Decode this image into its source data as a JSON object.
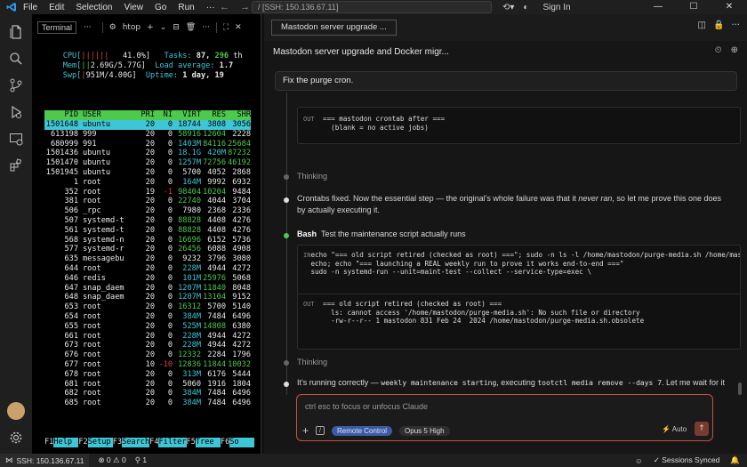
{
  "titlebar": {
    "menus": [
      "File",
      "Edit",
      "Selection",
      "View",
      "Go",
      "Run",
      "···"
    ],
    "command_center": "/ [SSH: 150.136.67.11]",
    "sign_in": "Sign In"
  },
  "terminal": {
    "tab_label": "Terminal",
    "tab_more": "···",
    "process_name": "htop",
    "meters": {
      "cpu_label": "CPU[",
      "cpu_bar": "||||||",
      "cpu_value": "41.0%]",
      "mem_label": "Mem[",
      "mem_bar": "||",
      "mem_value": "2.69G/5.77G]",
      "swp_label": "Swp[",
      "swp_bar": "|",
      "swp_value": "951M/4.00G]",
      "tasks_label": "Tasks:",
      "tasks_value": "87,",
      "threads_value": "296",
      "threads_suffix": "th",
      "load_label": "Load average:",
      "load_value": "1.7",
      "uptime_label": "Uptime:",
      "uptime_value": "1 day, 19"
    },
    "columns": [
      "PID",
      "USER",
      "PRI",
      "NI",
      "VIRT",
      "RES",
      "SHR"
    ],
    "rows": [
      {
        "pid": "1501648",
        "user": "ubuntu",
        "pri": "20",
        "ni": "0",
        "virt": "18744",
        "res": "3808",
        "shr": "3056"
      },
      {
        "pid": "613198",
        "user": "999",
        "pri": "20",
        "ni": "0",
        "virt": "58916",
        "res": "12604",
        "shr": "2228"
      },
      {
        "pid": "680999",
        "user": "991",
        "pri": "20",
        "ni": "0",
        "virt": "1403M",
        "res": "84116",
        "shr": "25684"
      },
      {
        "pid": "1501436",
        "user": "ubuntu",
        "pri": "20",
        "ni": "0",
        "virt": "18.1G",
        "res": "420M",
        "shr": "87232"
      },
      {
        "pid": "1501470",
        "user": "ubuntu",
        "pri": "20",
        "ni": "0",
        "virt": "1257M",
        "res": "72756",
        "shr": "46192"
      },
      {
        "pid": "1501945",
        "user": "ubuntu",
        "pri": "20",
        "ni": "0",
        "virt": "5700",
        "res": "4052",
        "shr": "2868"
      },
      {
        "pid": "1",
        "user": "root",
        "pri": "20",
        "ni": "0",
        "virt": "164M",
        "res": "9992",
        "shr": "6932"
      },
      {
        "pid": "352",
        "user": "root",
        "pri": "19",
        "ni": "-1",
        "virt": "98404",
        "res": "10204",
        "shr": "9484"
      },
      {
        "pid": "381",
        "user": "root",
        "pri": "20",
        "ni": "0",
        "virt": "22740",
        "res": "4044",
        "shr": "3704"
      },
      {
        "pid": "506",
        "user": "_rpc",
        "pri": "20",
        "ni": "0",
        "virt": "7980",
        "res": "2368",
        "shr": "2336"
      },
      {
        "pid": "507",
        "user": "systemd-t",
        "pri": "20",
        "ni": "0",
        "virt": "88828",
        "res": "4408",
        "shr": "4276"
      },
      {
        "pid": "561",
        "user": "systemd-t",
        "pri": "20",
        "ni": "0",
        "virt": "88828",
        "res": "4408",
        "shr": "4276"
      },
      {
        "pid": "568",
        "user": "systemd-n",
        "pri": "20",
        "ni": "0",
        "virt": "16696",
        "res": "6152",
        "shr": "5736"
      },
      {
        "pid": "577",
        "user": "systemd-r",
        "pri": "20",
        "ni": "0",
        "virt": "26456",
        "res": "6088",
        "shr": "4908"
      },
      {
        "pid": "635",
        "user": "messagebu",
        "pri": "20",
        "ni": "0",
        "virt": "9232",
        "res": "3796",
        "shr": "3080"
      },
      {
        "pid": "644",
        "user": "root",
        "pri": "20",
        "ni": "0",
        "virt": "228M",
        "res": "4944",
        "shr": "4272"
      },
      {
        "pid": "646",
        "user": "redis",
        "pri": "20",
        "ni": "0",
        "virt": "101M",
        "res": "25976",
        "shr": "5068"
      },
      {
        "pid": "647",
        "user": "snap_daem",
        "pri": "20",
        "ni": "0",
        "virt": "1207M",
        "res": "11840",
        "shr": "8048"
      },
      {
        "pid": "648",
        "user": "snap_daem",
        "pri": "20",
        "ni": "0",
        "virt": "1207M",
        "res": "13104",
        "shr": "9152"
      },
      {
        "pid": "653",
        "user": "root",
        "pri": "20",
        "ni": "0",
        "virt": "16312",
        "res": "5700",
        "shr": "5140"
      },
      {
        "pid": "654",
        "user": "root",
        "pri": "20",
        "ni": "0",
        "virt": "384M",
        "res": "7484",
        "shr": "6496"
      },
      {
        "pid": "655",
        "user": "root",
        "pri": "20",
        "ni": "0",
        "virt": "525M",
        "res": "14808",
        "shr": "6380"
      },
      {
        "pid": "661",
        "user": "root",
        "pri": "20",
        "ni": "0",
        "virt": "228M",
        "res": "4944",
        "shr": "4272"
      },
      {
        "pid": "673",
        "user": "root",
        "pri": "20",
        "ni": "0",
        "virt": "228M",
        "res": "4944",
        "shr": "4272"
      },
      {
        "pid": "676",
        "user": "root",
        "pri": "20",
        "ni": "0",
        "virt": "12332",
        "res": "2284",
        "shr": "1796"
      },
      {
        "pid": "677",
        "user": "root",
        "pri": "10",
        "ni": "-10",
        "virt": "12836",
        "res": "11844",
        "shr": "10032"
      },
      {
        "pid": "678",
        "user": "root",
        "pri": "20",
        "ni": "0",
        "virt": "313M",
        "res": "6176",
        "shr": "5444"
      },
      {
        "pid": "681",
        "user": "root",
        "pri": "20",
        "ni": "0",
        "virt": "5060",
        "res": "1916",
        "shr": "1804"
      },
      {
        "pid": "682",
        "user": "root",
        "pri": "20",
        "ni": "0",
        "virt": "384M",
        "res": "7484",
        "shr": "6496"
      },
      {
        "pid": "685",
        "user": "root",
        "pri": "20",
        "ni": "0",
        "virt": "384M",
        "res": "7484",
        "shr": "6496"
      }
    ],
    "fkeys": [
      {
        "key": "F1",
        "label": "Help"
      },
      {
        "key": "F2",
        "label": "Setup"
      },
      {
        "key": "F3",
        "label": "Search"
      },
      {
        "key": "F4",
        "label": "Filter"
      },
      {
        "key": "F5",
        "label": "Tree"
      },
      {
        "key": "F6",
        "label": "So"
      }
    ]
  },
  "editor": {
    "tab_title": "Mastodon server upgrade ...",
    "conversation_title": "Mastodon server upgrade and Docker migr...",
    "prompt": "Fix the purge cron.",
    "out1_label": "OUT",
    "out1_lines": [
      "=== mastodon crontab after ===",
      "(blank = no active jobs)"
    ],
    "thinking1": "Thinking",
    "message1_a": "Crontabs fixed. Now the essential step — the original's whole failure was that it ",
    "message1_em": "never ran",
    "message1_b": ", so let me prove this one does",
    "message1_c": "by actually executing it.",
    "bash_label": "Bash",
    "bash_desc": "Test the maintenance script actually runs",
    "in_label": "IN",
    "in_lines": [
      "echo \"=== old script retired (checked as root) ===\"; sudo -n ls -l /home/mastodon/purge-media.sh /home/mas",
      "echo; echo \"=== launching a REAL weekly run to prove it works end-to-end ===\"",
      "sudo -n systemd-run --unit=maint-test --collect --service-type=exec \\"
    ],
    "out2_label": "OUT",
    "out2_lines": [
      "=== old script retired (checked as root) ===",
      "ls: cannot access '/home/mastodon/purge-media.sh': No such file or directory",
      "-rw-r--r-- 1 mastodon 831 Feb 24  2024 /home/mastodon/purge-media.sh.obsolete"
    ],
    "thinking2": "Thinking",
    "message2_a": "It's running correctly — ",
    "message2_code1": "weekly maintenance starting",
    "message2_b": ", executing ",
    "message2_code2": "tootctl media remove --days 7",
    "message2_c": ". Let me wait for it",
    "input_placeholder": "ctrl esc to focus or unfocus Claude",
    "chip_remote": "Remote Control",
    "chip_model": "Opus 5 High",
    "auto_label": "Auto"
  },
  "statusbar": {
    "remote": "SSH: 150.136.67.11",
    "problems": "0",
    "warnings": "0",
    "ports": "1",
    "sync": "Sessions Synced"
  }
}
